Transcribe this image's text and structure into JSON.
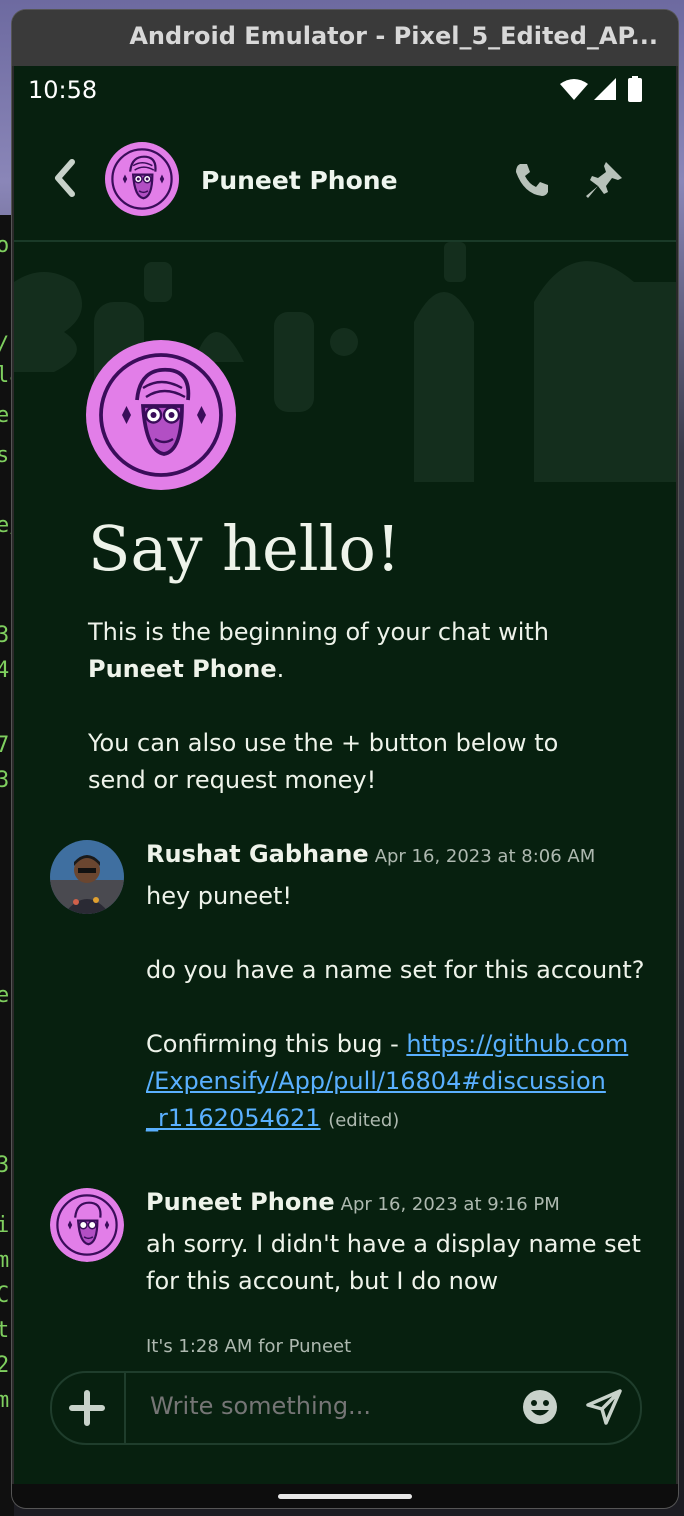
{
  "window": {
    "title": "Android Emulator - Pixel_5_Edited_AP..."
  },
  "status_bar": {
    "time": "10:58"
  },
  "header": {
    "contact_name": "Puneet Phone"
  },
  "intro": {
    "heading": "Say hello!",
    "line1_prefix": "This is the beginning of your chat with",
    "line1_name": "Puneet Phone",
    "line1_suffix": ".",
    "line2": "You can also use the + button below to send or request money!"
  },
  "messages": [
    {
      "author": "Rushat Gabhane",
      "timestamp": "Apr 16, 2023 at 8:06 AM",
      "p1": "hey puneet!",
      "p2": "do you have a name set for this account?",
      "p3_prefix": "Confirming this bug - ",
      "link": "https://github.com/Expensify/App/pull/16804#discussion_r1162054621",
      "link_l1": "https://github.com",
      "link_l2": "/Expensify/App/pull/16804#discussion",
      "link_l3": "_r1162054621",
      "edited": "(edited)"
    },
    {
      "author": "Puneet Phone",
      "timestamp": "Apr 16, 2023 at 9:16 PM",
      "text": "ah sorry. I didn't have a display name set for this account, but I do now"
    }
  ],
  "local_time_note": "It's 1:28 AM for Puneet",
  "composer": {
    "placeholder": "Write something..."
  },
  "icons": {
    "back": "chevron-left-icon",
    "call": "phone-icon",
    "pin": "pin-icon",
    "add": "plus-icon",
    "emoji": "emoji-icon",
    "send": "send-icon"
  },
  "colors": {
    "background": "#07200f",
    "text": "#eef3ea",
    "muted": "#aeb9b0",
    "link": "#5ab0ff",
    "avatar_pink": "#e27ee8",
    "avatar_dark": "#3a0d5a"
  }
}
